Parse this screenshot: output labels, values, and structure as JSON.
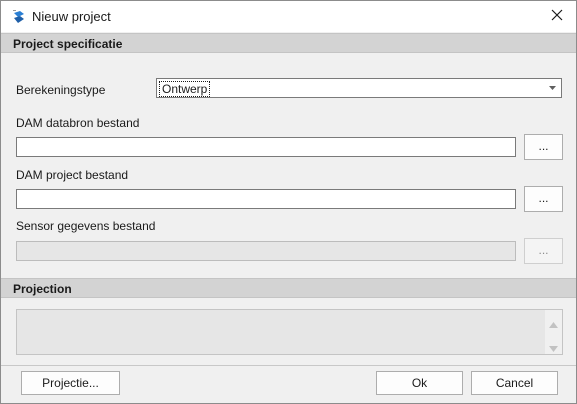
{
  "window": {
    "title": "Nieuw project",
    "app_icon": "app-logo-icon",
    "close_icon": "close-icon"
  },
  "sections": {
    "project_spec": "Project specificatie",
    "projection": "Projection"
  },
  "fields": {
    "calc_type_label": "Berekeningstype",
    "calc_type_value": "Ontwerp",
    "databron_label": "DAM databron bestand",
    "databron_value": "",
    "project_label": "DAM project bestand",
    "project_value": "",
    "sensor_label": "Sensor gegevens bestand",
    "sensor_value": "",
    "browse_label": "..."
  },
  "buttons": {
    "projectie": "Projectie...",
    "ok": "Ok",
    "cancel": "Cancel"
  },
  "colors": {
    "section_header": "#d3d3d3",
    "window_bg": "#f0f0f0",
    "icon_blue": "#2a7fd4"
  }
}
